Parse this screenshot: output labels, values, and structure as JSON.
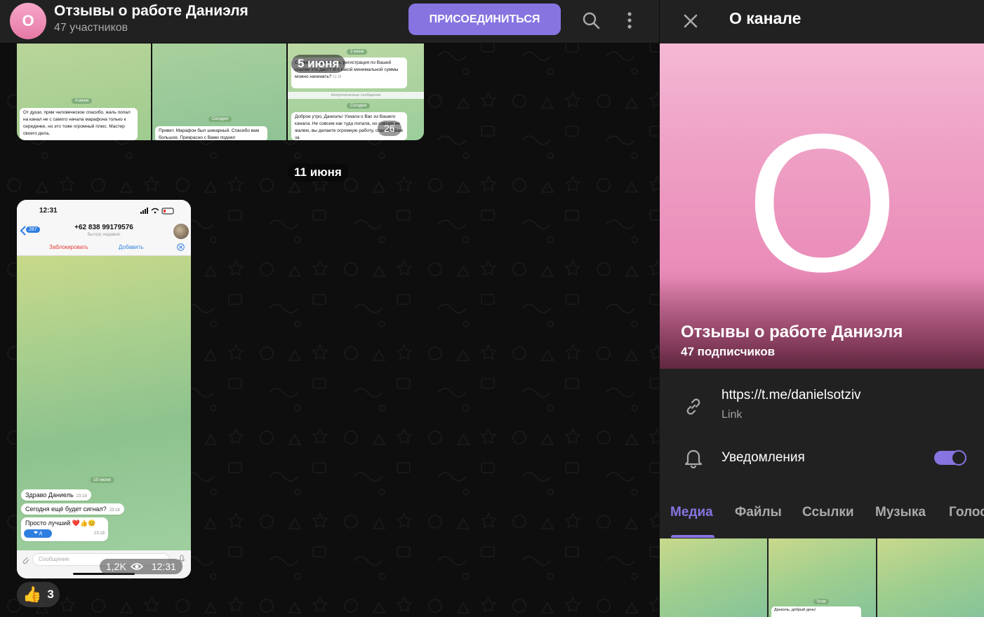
{
  "chat_header": {
    "avatar_letter": "О",
    "title": "Отзывы о работе Даниэля",
    "subtitle": "47 участников",
    "join_label": "ПРИСОЕДИНИТЬСЯ",
    "search_icon": "search-icon",
    "menu_icon": "more-vertical-icon"
  },
  "album": {
    "date_badge": "5 июня",
    "time_badge_partial": "26",
    "cell1": {
      "date": "4 июня",
      "text": "От души, прям человеческое спасибо, жаль попал на канал не с самого начала марафона только к серединке, но это тоже огромный плюс. Мастер своего дела,"
    },
    "cell2": {
      "date": "Сегодня",
      "text": "Привет. Марафон был шикарный. Спасибо вам большое. Прекрасно с Вами поднял"
    },
    "cell3": {
      "date_top": "2 июня",
      "text_top": "Скажите, пожалуйста, регистрация по Вашей ссылке что даст? И с какой минимальной суммы можно начинать?",
      "time_top": "11:15",
      "divider": "Непрочитанные сообщения",
      "date_bottom": "Сегодня",
      "text_bottom": "Доброе утро, Даниэль! Узнала о Вас из Вашего канала. Не совсем как туда попала, но совсем не жалею, вы делаете огромную работу, спасибо Вам за"
    }
  },
  "date_separator": "11 июня",
  "photo_message": {
    "status_time": "12:31",
    "back_count": "287",
    "contact_phone": "+62 838 99179576",
    "contact_status": "был(а) недавно",
    "block_label": "Заблокировать",
    "add_label": "Добавить",
    "date_chip": "10 июня",
    "messages": [
      {
        "text": "Здраво Даниель",
        "time": "23:18"
      },
      {
        "text": "Сегодня ещё будет сигнал?",
        "time": "23:18"
      },
      {
        "text": "Просто лучший",
        "time": "23:19"
      }
    ],
    "input_placeholder": "Сообщение",
    "views": "1,2K",
    "time": "12:31"
  },
  "reaction": {
    "emoji": "👍",
    "count": "3"
  },
  "panel": {
    "title": "О канале",
    "avatar_letter": "О",
    "channel_name": "Отзывы о работе Даниэля",
    "subscribers": "47 подписчиков",
    "link_value": "https://t.me/danielsotziv",
    "link_caption": "Link",
    "notifications_label": "Уведомления",
    "notifications_on": true,
    "tabs": [
      {
        "label": "Медиа",
        "active": true
      },
      {
        "label": "Файлы",
        "active": false
      },
      {
        "label": "Ссылки",
        "active": false
      },
      {
        "label": "Музыка",
        "active": false
      },
      {
        "label": "Голос",
        "active": false
      }
    ],
    "media_preview": {
      "date": "Тундр",
      "text": "Даниэль, добрый день!"
    }
  },
  "colors": {
    "accent": "#8774e1",
    "panel_bg": "#212121",
    "chat_bg": "#0e0e0e",
    "avatar_pink": "#ee9fc4"
  }
}
